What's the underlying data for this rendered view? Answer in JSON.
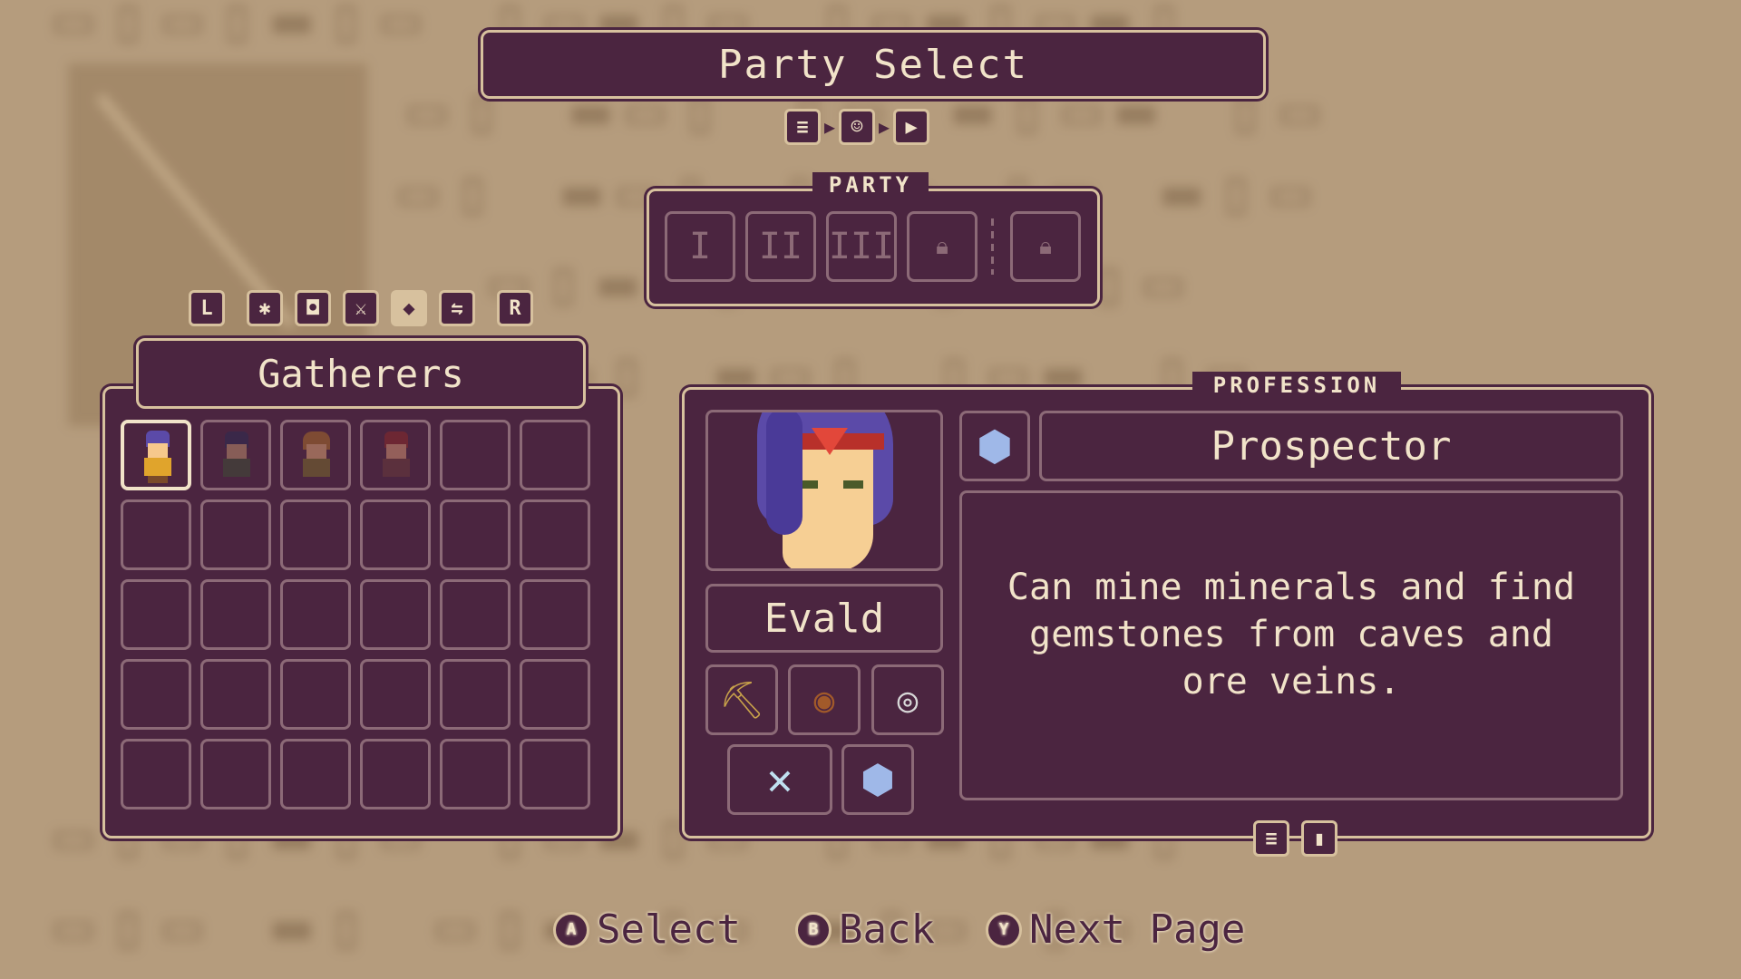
{
  "header": {
    "title": "Party Select",
    "nav_icons": [
      "list-icon",
      "face-icon",
      "play-icon"
    ]
  },
  "party": {
    "label": "PARTY",
    "slots": [
      "I",
      "II",
      "III",
      "",
      ""
    ]
  },
  "roster": {
    "filter_left": "L",
    "filter_right": "R",
    "category": "Gatherers"
  },
  "profession": {
    "label": "PROFESSION",
    "name": "Prospector",
    "description": "Can mine minerals and find gemstones from caves and ore veins."
  },
  "character": {
    "name": "Evald"
  },
  "hints": {
    "select_btn": "A",
    "select": "Select",
    "back_btn": "B",
    "back": "Back",
    "next_btn": "Y",
    "next": "Next Page"
  },
  "colors": {
    "panel": "#4b2540",
    "border": "#d7c19e",
    "text": "#f1e3c9",
    "background": "#b59c7d"
  }
}
